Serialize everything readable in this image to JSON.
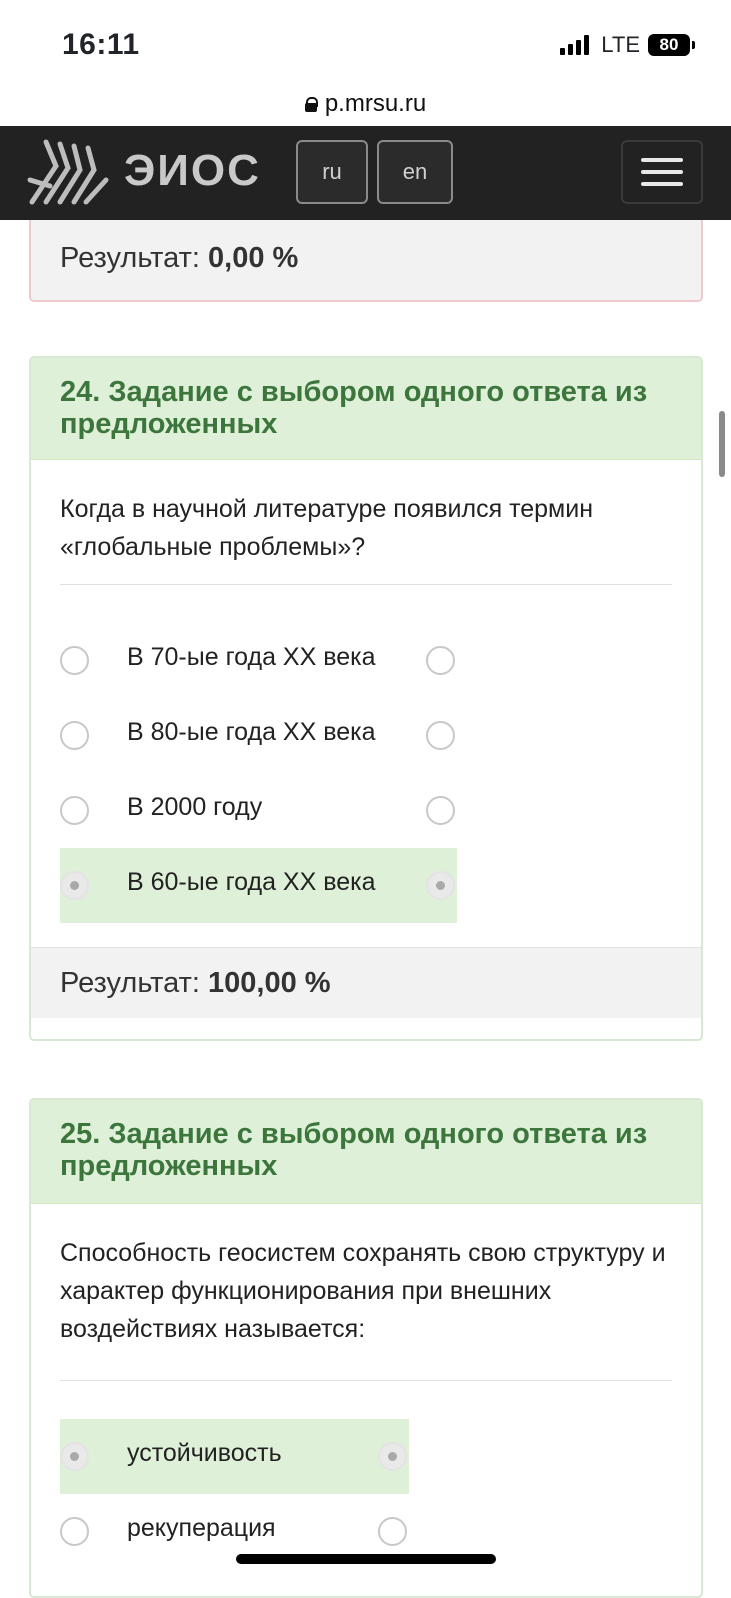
{
  "status_bar": {
    "time": "16:11",
    "network": "LTE",
    "battery": "80"
  },
  "browser": {
    "url": "p.mrsu.ru"
  },
  "navbar": {
    "brand": "ЭИОС",
    "lang_ru": "ru",
    "lang_en": "en"
  },
  "previous_card": {
    "result_label": "Результат:",
    "result_value": "0,00 %"
  },
  "tasks": [
    {
      "title": "24. Задание с выбором одного ответа из предложенных",
      "question": "Когда в научной литературе появился термин «глобальные проблемы»?",
      "answers": [
        {
          "label": "В 70-ые года XX века",
          "selected": false
        },
        {
          "label": "В 80-ые года XX века",
          "selected": false
        },
        {
          "label": "В 2000 году",
          "selected": false
        },
        {
          "label": "В 60-ые года XX века",
          "selected": true
        }
      ],
      "result_label": "Результат:",
      "result_value": "100,00 %"
    },
    {
      "title": "25. Задание с выбором одного ответа из предложенных",
      "question": "Способность геосистем сохранять свою структуру и характер функционирования при внешних воздействиях называется:",
      "answers": [
        {
          "label": "устойчивость",
          "selected": true
        },
        {
          "label": "рекуперация",
          "selected": false
        }
      ]
    }
  ],
  "colors": {
    "navbar_bg": "#222222",
    "header_bg": "#dff0d8",
    "header_text": "#3c763d",
    "selected_bg": "#dff0d8",
    "footer_bg": "#f2f2f2"
  }
}
